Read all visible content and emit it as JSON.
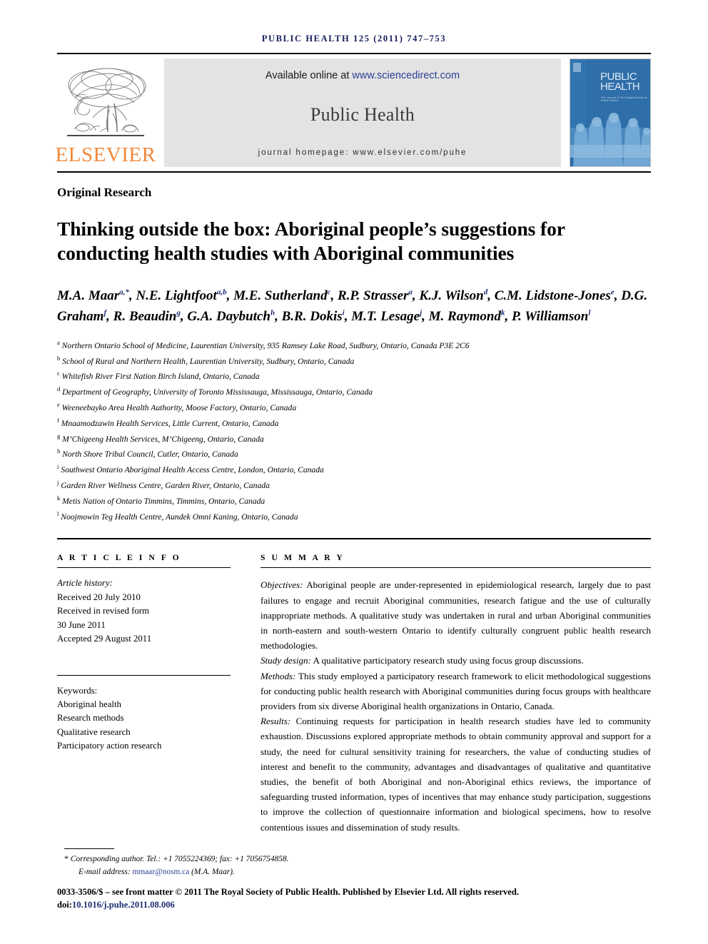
{
  "running_head": "PUBLIC HEALTH 125 (2011) 747–753",
  "masthead": {
    "elsevier_wordmark": "ELSEVIER",
    "available_prefix": "Available online at ",
    "sciencedirect_url": "www.sciencedirect.com",
    "journal_name": "Public Health",
    "homepage_line": "journal homepage: www.elsevier.com/puhe",
    "cover_title_line1": "PUBLIC",
    "cover_title_line2": "HEALTH",
    "cover_subtitle": "The Journal of The Royal Society for Public Health"
  },
  "article": {
    "type": "Original Research",
    "title": "Thinking outside the box: Aboriginal people’s suggestions for conducting health studies with Aboriginal communities",
    "authors_line1": "M.A. Maar",
    "authors_html": "M.A. Maar a,*, N.E. Lightfoot a,b, M.E. Sutherland c, R.P. Strasser a, K.J. Wilson d, C.M. Lidstone-Jones e, D.G. Graham f, R. Beaudin g, G.A. Daybutch h, B.R. Dokis i, M.T. Lesage j, M. Raymond k, P. Williamson l"
  },
  "authors": [
    {
      "name": "M.A. Maar",
      "marks": "a,*",
      "sep": ", "
    },
    {
      "name": "N.E. Lightfoot",
      "marks": "a,b",
      "sep": ", "
    },
    {
      "name": "M.E. Sutherland",
      "marks": "c",
      "sep": ", "
    },
    {
      "name": "R.P. Strasser",
      "marks": "a",
      "sep": ", "
    },
    {
      "name": "K.J. Wilson",
      "marks": "d",
      "sep": ", "
    },
    {
      "name": "C.M. Lidstone-Jones",
      "marks": "e",
      "sep": ", "
    },
    {
      "name": "D.G. Graham",
      "marks": "f",
      "sep": ", "
    },
    {
      "name": "R. Beaudin",
      "marks": "g",
      "sep": ", "
    },
    {
      "name": "G.A. Daybutch",
      "marks": "h",
      "sep": ", "
    },
    {
      "name": "B.R. Dokis",
      "marks": "i",
      "sep": ", "
    },
    {
      "name": "M.T. Lesage",
      "marks": "j",
      "sep": ", "
    },
    {
      "name": "M. Raymond",
      "marks": "k",
      "sep": ", "
    },
    {
      "name": "P. Williamson",
      "marks": "l",
      "sep": ""
    }
  ],
  "affiliations": [
    {
      "mark": "a",
      "text": "Northern Ontario School of Medicine, Laurentian University, 935 Ramsey Lake Road, Sudbury, Ontario, Canada P3E 2C6"
    },
    {
      "mark": "b",
      "text": "School of Rural and Northern Health, Laurentian University, Sudbury, Ontario, Canada"
    },
    {
      "mark": "c",
      "text": "Whitefish River First Nation Birch Island, Ontario, Canada"
    },
    {
      "mark": "d",
      "text": "Department of Geography, University of Toronto Mississauga, Mississauga, Ontario, Canada"
    },
    {
      "mark": "e",
      "text": "Weeneebayko Area Health Authority, Moose Factory, Ontario, Canada"
    },
    {
      "mark": "f",
      "text": "Mnaamodzawin Health Services, Little Current, Ontario, Canada"
    },
    {
      "mark": "g",
      "text": "M’Chigeeng Health Services, M’Chigeeng, Ontario, Canada"
    },
    {
      "mark": "h",
      "text": "North Shore Tribal Council, Cutler, Ontario, Canada"
    },
    {
      "mark": "i",
      "text": "Southwest Ontario Aboriginal Health Access Centre, London, Ontario, Canada"
    },
    {
      "mark": "j",
      "text": "Garden River Wellness Centre, Garden River, Ontario, Canada"
    },
    {
      "mark": "k",
      "text": "Metis Nation of Ontario Timmins, Timmins, Ontario, Canada"
    },
    {
      "mark": "l",
      "text": "Noojmowin Teg Health Centre, Aundek Omni Kaning, Ontario, Canada"
    }
  ],
  "article_info": {
    "heading": "A R T I C L E  I N F O",
    "history_label": "Article history:",
    "history": [
      "Received 20 July 2010",
      "Received in revised form",
      "30 June 2011",
      "Accepted 29 August 2011"
    ],
    "keywords_label": "Keywords:",
    "keywords": [
      "Aboriginal health",
      "Research methods",
      "Qualitative research",
      "Participatory action research"
    ]
  },
  "summary": {
    "heading": "S U M M A R Y",
    "sections": [
      {
        "label": "Objectives:",
        "text": " Aboriginal people are under-represented in epidemiological research, largely due to past failures to engage and recruit Aboriginal communities, research fatigue and the use of culturally inappropriate methods. A qualitative study was undertaken in rural and urban Aboriginal communities in north-eastern and south-western Ontario to identify culturally congruent public health research methodologies."
      },
      {
        "label": "Study design:",
        "text": " A qualitative participatory research study using focus group discussions."
      },
      {
        "label": "Methods:",
        "text": " This study employed a participatory research framework to elicit methodological suggestions for conducting public health research with Aboriginal communities during focus groups with healthcare providers from six diverse Aboriginal health organizations in Ontario, Canada."
      },
      {
        "label": "Results:",
        "text": " Continuing requests for participation in health research studies have led to community exhaustion. Discussions explored appropriate methods to obtain community approval and support for a study, the need for cultural sensitivity training for researchers, the value of conducting studies of interest and benefit to the community, advantages and disadvantages of qualitative and quantitative studies, the benefit of both Aboriginal and non-Aboriginal ethics reviews, the importance of safeguarding trusted information, types of incentives that may enhance study participation, suggestions to improve the collection of questionnaire information and biological specimens, how to resolve contentious issues and dissemination of study results."
      }
    ]
  },
  "footer": {
    "corresponding_star": "*",
    "corresponding_text": "Corresponding author. Tel.: +1 7055224369; fax: +1 7056754858.",
    "email_label": "E-mail address: ",
    "email": "mmaar@nosm.ca",
    "email_suffix": " (M.A. Maar).",
    "copyright": "0033-3506/$ – see front matter © 2011 The Royal Society of Public Health. Published by Elsevier Ltd. All rights reserved.",
    "doi_label": "doi:",
    "doi": "10.1016/j.puhe.2011.08.006"
  },
  "colors": {
    "running_head": "#141e5a",
    "link_blue": "#2b3f95",
    "elsevier_orange": "#f0883a",
    "banner_grey": "#e3e3e3",
    "cover_blue": "#2a6cab",
    "cover_blue_light": "#6fa8d4"
  }
}
